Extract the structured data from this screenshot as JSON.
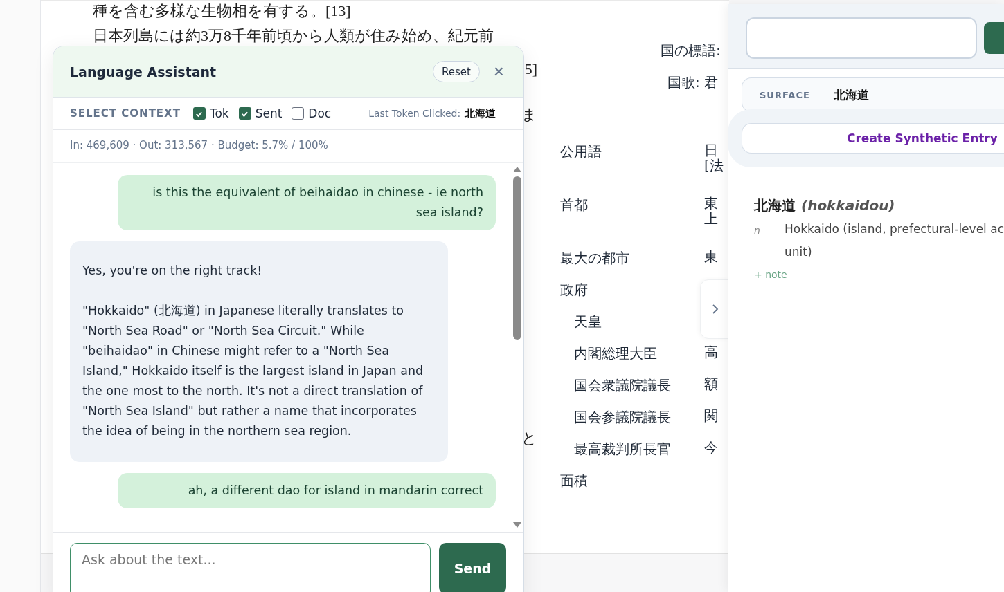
{
  "article": {
    "paragraph_1": "種を含む多様な生物相を有する。[13]",
    "paragraph_2": "日本列島には約3万8千年前頃から人類が住み始め、紀元前",
    "fragments": [
      "5]",
      "ま",
      "と"
    ]
  },
  "infobox": {
    "motto": "国の標語:",
    "anthem": "国歌: 君",
    "rows": [
      {
        "label": "公用語",
        "values": [
          "日",
          "[法"
        ]
      },
      {
        "label": "首都",
        "values": [
          "東",
          "上"
        ]
      },
      {
        "label": "最大の都市",
        "values": [
          "東"
        ]
      },
      {
        "label": "政府",
        "children": [
          {
            "label": "天皇"
          },
          {
            "label": "内閣総理大臣",
            "values": [
              "高"
            ]
          },
          {
            "label": "国会衆議院議長",
            "values": [
              "額"
            ]
          },
          {
            "label": "国会参議院議長",
            "values": [
              "関"
            ]
          },
          {
            "label": "最高裁判所長官",
            "values": [
              "今"
            ]
          }
        ]
      },
      {
        "label": "面積"
      }
    ]
  },
  "assistant": {
    "title": "Language Assistant",
    "reset": "Reset",
    "close": "×",
    "context_label": "SELECT CONTEXT",
    "context": [
      {
        "label": "Tok",
        "checked": true
      },
      {
        "label": "Sent",
        "checked": true
      },
      {
        "label": "Doc",
        "checked": false
      }
    ],
    "last_token_label": "Last Token Clicked:",
    "last_token": "北海道",
    "stats": "In: 469,609 · Out: 313,567 · Budget: 5.7% / 100%",
    "messages": [
      {
        "kind": "user",
        "paragraphs": [
          "is this the equivalent of beihaidao in chinese - ie north sea island?"
        ]
      },
      {
        "kind": "assistant",
        "paragraphs": [
          "Yes, you're on the right track!",
          "\"Hokkaido\" (北海道) in Japanese literally translates to \"North Sea Road\" or \"North Sea Circuit.\" While \"beihaidao\" in Chinese might refer to a \"North Sea Island,\" Hokkaido itself is the largest island in Japan and the one most to the north. It's not a direct translation of \"North Sea Island\" but rather a name that incorporates the idea of being in the northern sea region."
        ]
      },
      {
        "kind": "user",
        "paragraphs": [
          "ah, a different dao for island in mandarin correct"
        ]
      }
    ],
    "input": {
      "placeholder": "Ask about the text..."
    },
    "send": "Send"
  },
  "dictionary": {
    "surface_label": "SURFACE",
    "surface": "北海道",
    "create": "Create Synthetic Entry",
    "entry": {
      "headword": "北海道",
      "reading": "(hokkaidou)",
      "pos": "n",
      "gloss": "Hokkaido (island, prefectural-level ac\nunit)",
      "note": "+ note"
    }
  }
}
